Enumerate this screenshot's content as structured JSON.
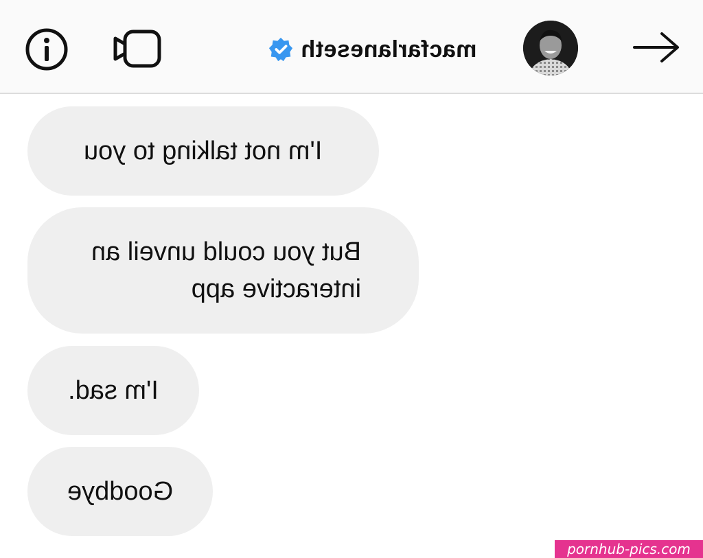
{
  "header": {
    "username": "macfarlaneseth",
    "icons": {
      "info": "info-icon",
      "video_call": "video-call-icon",
      "verified": "verified-badge-icon",
      "forward": "arrow-right-icon"
    },
    "verified_color": "#3897f0"
  },
  "messages": [
    {
      "lines": [
        "I'm not talking to you"
      ]
    },
    {
      "lines": [
        "But you could unveil an",
        "interactive app"
      ]
    },
    {
      "lines": [
        "I'm sad."
      ]
    },
    {
      "lines": [
        "Goodbye"
      ]
    }
  ],
  "colors": {
    "bubble_bg": "#efefef",
    "header_bg": "#fafafa",
    "watermark_bg": "#e5338f"
  },
  "watermark": "pornhub-pics.com"
}
